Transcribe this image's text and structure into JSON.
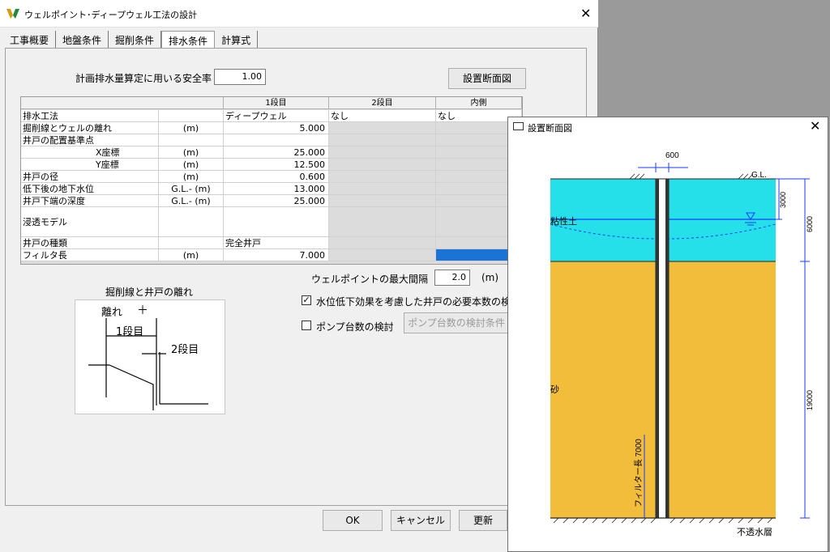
{
  "main": {
    "title": "ウェルポイント･ディープウェル工法の設計",
    "tabs": [
      {
        "label": "工事概要"
      },
      {
        "label": "地盤条件"
      },
      {
        "label": "掘削条件"
      },
      {
        "label": "排水条件"
      },
      {
        "label": "計算式"
      }
    ],
    "safety_label": "計画排水量算定に用いる安全率",
    "safety_value": "1.00",
    "section_button": "設置断面図",
    "table": {
      "headers": [
        "1段目",
        "2段目",
        "内側"
      ],
      "rows": [
        {
          "name": "排水工法",
          "unit": "",
          "v1": "ディープウェル",
          "v2": "なし",
          "v3": "なし"
        },
        {
          "name": "掘削線とウェルの離れ",
          "unit": "(m)",
          "v1": "5.000"
        },
        {
          "name": "井戸の配置基準点",
          "unit": "",
          "v1": ""
        },
        {
          "name": "X座標",
          "unit": "(m)",
          "v1": "25.000"
        },
        {
          "name": "Y座標",
          "unit": "(m)",
          "v1": "12.500"
        },
        {
          "name": "井戸の径",
          "unit": "(m)",
          "v1": "0.600"
        },
        {
          "name": "低下後の地下水位",
          "unit": "G.L.- (m)",
          "v1": "13.000"
        },
        {
          "name": "井戸下端の深度",
          "unit": "G.L.- (m)",
          "v1": "25.000"
        },
        {
          "name": "浸透モデル",
          "unit": "",
          "v1": ""
        },
        {
          "name": "井戸の種類",
          "unit": "",
          "v1": "完全井戸"
        },
        {
          "name": "フィルタ長",
          "unit": "(m)",
          "v1": "7.000"
        }
      ]
    },
    "sketch": {
      "title": "掘削線と井戸の離れ",
      "label_distance": "離れ",
      "label_stage1": "1段目",
      "label_stage2": "2段目"
    },
    "max_spacing_label": "ウェルポイントの最大間隔",
    "max_spacing_value": "2.0",
    "max_spacing_unit": "(m)",
    "check_water": {
      "label": "水位低下効果を考慮した井戸の必要本数の検討",
      "checked": true
    },
    "check_pump": {
      "label": "ポンプ台数の検討",
      "checked": false
    },
    "pump_button": "ポンプ台数の検討条件",
    "footer": {
      "ok": "OK",
      "cancel": "キャンセル",
      "update": "更新"
    }
  },
  "section": {
    "title": "設置断面図",
    "labels": {
      "well_diameter": "600",
      "gl": "G.L.",
      "clay": "粘性土",
      "sand": "砂",
      "filter": "フィルター長 7000",
      "impermeable": "不透水層",
      "dim_3000": "3000",
      "dim_6000": "6000",
      "dim_19000": "19000"
    },
    "colors": {
      "clay": "#25e0e8",
      "sand": "#f3bd3c",
      "line": "#1a3cff"
    }
  }
}
